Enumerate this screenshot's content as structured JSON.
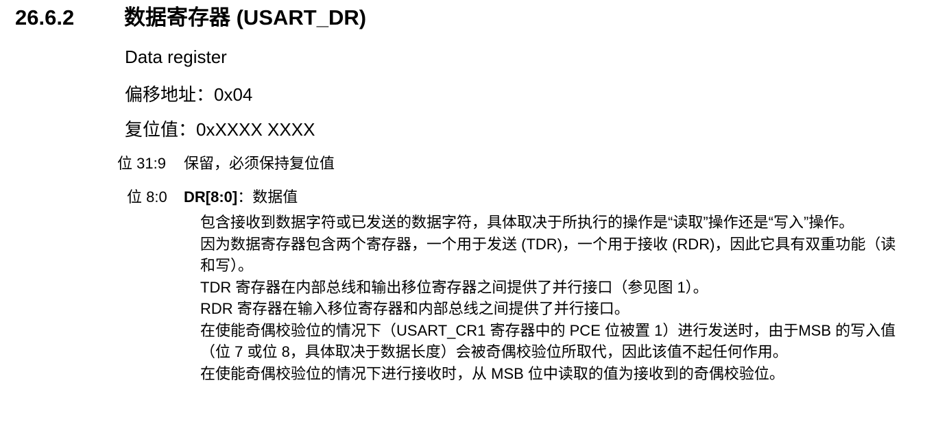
{
  "section": {
    "number": "26.6.2",
    "title": "数据寄存器 (USART_DR)"
  },
  "register": {
    "english_name": "Data register",
    "offset_line": "偏移地址：0x04",
    "reset_line": "复位值：0xXXXX XXXX"
  },
  "bits": [
    {
      "label": "位 31:9",
      "description": "保留，必须保持复位值"
    },
    {
      "label": "位 8:0",
      "field": "DR[8:0]",
      "field_suffix": "：数据值",
      "paragraphs": [
        "包含接收到数据字符或已发送的数据字符，具体取决于所执行的操作是“读取”操作还是“写入”操作。",
        "因为数据寄存器包含两个寄存器，一个用于发送 (TDR)，一个用于接收 (RDR)，因此它具有双重功能（读和写）。",
        "TDR 寄存器在内部总线和输出移位寄存器之间提供了并行接口（参见图 1）。",
        "RDR 寄存器在输入移位寄存器和内部总线之间提供了并行接口。",
        "在使能奇偶校验位的情况下（USART_CR1 寄存器中的 PCE 位被置 1）进行发送时，由于MSB 的写入值（位 7 或位 8，具体取决于数据长度）会被奇偶校验位所取代，因此该值不起任何作用。",
        "在使能奇偶校验位的情况下进行接收时，从 MSB 位中读取的值为接收到的奇偶校验位。"
      ]
    }
  ]
}
